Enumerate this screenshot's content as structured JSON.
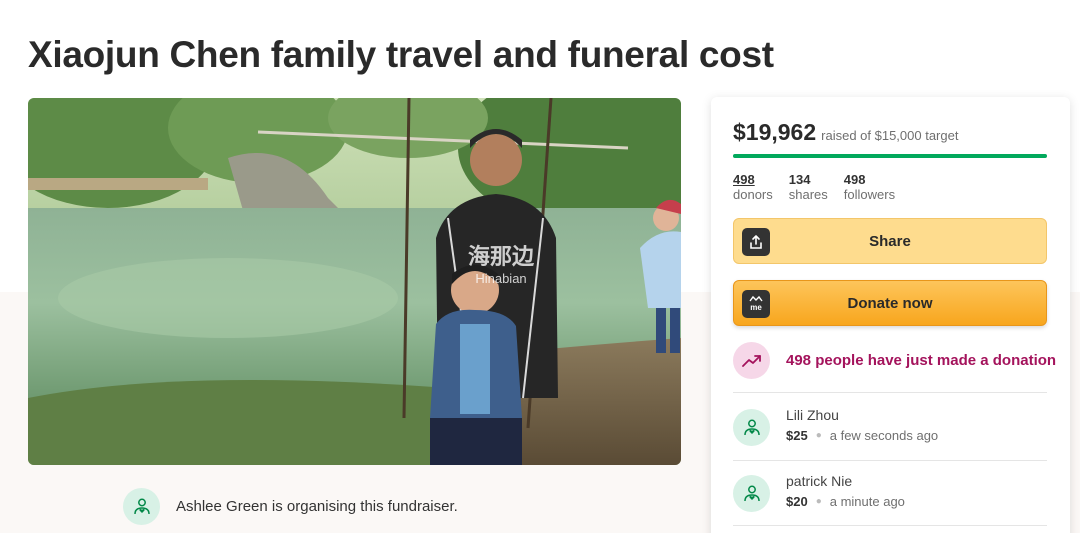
{
  "campaign": {
    "title": "Xiaojun Chen family travel and funeral cost",
    "watermark_cn": "海那边",
    "watermark_en": "Hinabian",
    "organiser_text": "Ashlee Green is organising this fundraiser."
  },
  "summary": {
    "raised_amount": "$19,962",
    "raised_of": "raised of $15,000 target",
    "progress_fraction": 1.0,
    "stats": [
      {
        "num": "498",
        "label": "donors"
      },
      {
        "num": "134",
        "label": "shares"
      },
      {
        "num": "498",
        "label": "followers"
      }
    ]
  },
  "buttons": {
    "share_label": "Share",
    "donate_label": "Donate now",
    "donate_icon_text": "me"
  },
  "recent_donations_text": "498 people have just made a donation",
  "donors": [
    {
      "name": "Lili Zhou",
      "amount": "$25",
      "time": "a few seconds ago"
    },
    {
      "name": "patrick Nie",
      "amount": "$20",
      "time": "a minute ago"
    }
  ],
  "colors": {
    "progress": "#02a95c",
    "donate_button": "#f8a61d",
    "share_button": "#fedc8e",
    "recent_text": "#a4135c",
    "avatar_bg": "#d8f1e6"
  },
  "icons": {
    "share": "share-upload-icon",
    "donate": "gofundme-logo-icon",
    "trend": "trending-up-icon",
    "donor": "heart-hand-user-icon"
  }
}
